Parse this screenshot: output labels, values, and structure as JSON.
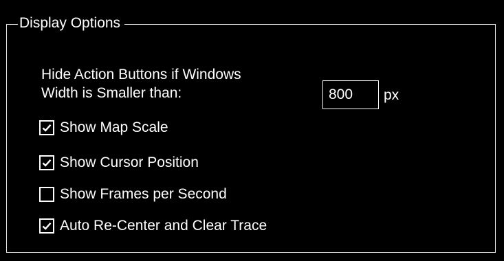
{
  "colors": {
    "background": "#000000",
    "foreground": "#ffffff",
    "frame": "#e8e8e8"
  },
  "group": {
    "title": "Display Options"
  },
  "width_setting": {
    "label_line1": "Hide Action Buttons if Windows",
    "label_line2": "Width is Smaller than:",
    "value": "800",
    "unit": "px"
  },
  "options": [
    {
      "label": "Show Map Scale",
      "checked": true,
      "icon": "checkmark-icon"
    },
    {
      "label": "Show Cursor Position",
      "checked": true,
      "icon": "checkmark-icon"
    },
    {
      "label": "Show Frames per Second",
      "checked": false,
      "icon": "checkmark-icon"
    },
    {
      "label": "Auto Re-Center and Clear Trace",
      "checked": true,
      "icon": "checkmark-icon"
    }
  ]
}
